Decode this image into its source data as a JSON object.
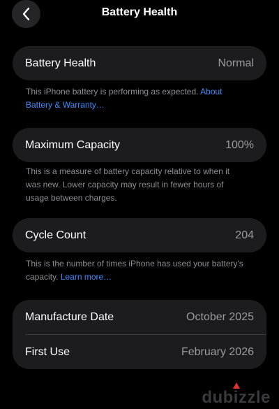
{
  "nav": {
    "title": "Battery Health",
    "back_icon": "chevron-left-icon"
  },
  "battery_health": {
    "label": "Battery Health",
    "value": "Normal",
    "footnote": "This iPhone battery is performing as expected.",
    "link": "About Battery & Warranty…"
  },
  "maximum_capacity": {
    "label": "Maximum Capacity",
    "value": "100%",
    "footnote": "This is a measure of battery capacity relative to when it was new. Lower capacity may result in fewer hours of usage between charges."
  },
  "cycle_count": {
    "label": "Cycle Count",
    "value": "204",
    "footnote": "This is the number of times iPhone has used your battery's capacity.",
    "link": "Learn more…"
  },
  "dates": {
    "manufacture_label": "Manufacture Date",
    "manufacture_value": "October 2025",
    "first_use_label": "First Use",
    "first_use_value": "February 2026"
  },
  "watermark": {
    "text": "dubizzle"
  },
  "colors": {
    "background": "#000000",
    "card": "#1c1c1e",
    "link": "#3f8cff",
    "secondary_text": "#8e8e93",
    "watermark_accent": "#e0312f"
  }
}
